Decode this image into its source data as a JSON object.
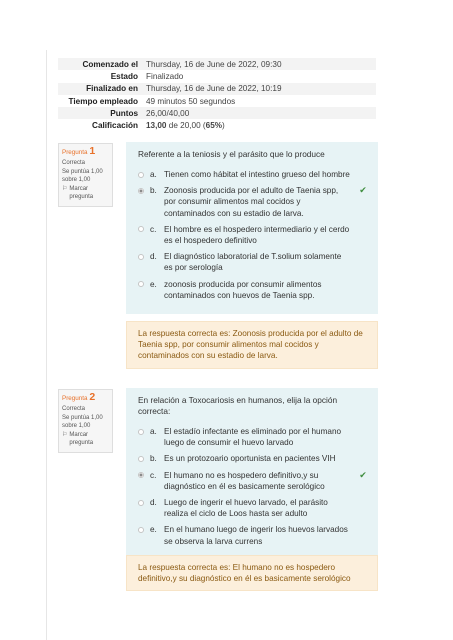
{
  "summary": [
    {
      "label": "Comenzado el",
      "value": "Thursday, 16 de June de 2022, 09:30"
    },
    {
      "label": "Estado",
      "value": "Finalizado"
    },
    {
      "label": "Finalizado en",
      "value": "Thursday, 16 de June de 2022, 10:19"
    },
    {
      "label": "Tiempo empleado",
      "value": "49 minutos 50 segundos"
    },
    {
      "label": "Puntos",
      "value": "26,00/40,00"
    },
    {
      "label": "Calificación",
      "value_bold": "13,00",
      "value_mid": " de 20,00 (",
      "value_pct": "65%",
      "value_end": ")"
    }
  ],
  "questions": [
    {
      "label": "Pregunta",
      "number": "1",
      "state": "Correcta",
      "mark": "Se puntúa 1,00 sobre 1,00",
      "flag_icon": "flag-icon",
      "flag_label": "Marcar pregunta",
      "text": "Referente a la teniosis y el parásito que lo produce",
      "options": [
        {
          "letter": "a.",
          "text": "Tienen como hábitat el intestino grueso del hombre",
          "selected": false,
          "correct": false
        },
        {
          "letter": "b.",
          "text": "Zoonosis producida por el adulto de Taenia spp, por consumir alimentos mal cocidos y contaminados con su estadio de larva.",
          "selected": true,
          "correct": true
        },
        {
          "letter": "c.",
          "text": "El hombre es el hospedero intermediario y el cerdo es el hospedero definitivo",
          "selected": false,
          "correct": false
        },
        {
          "letter": "d.",
          "text": "El diagnóstico laboratorial de T.solium solamente es por serología",
          "selected": false,
          "correct": false
        },
        {
          "letter": "e.",
          "text": "zoonosis producida por consumir alimentos contaminados con huevos de Taenia spp.",
          "selected": false,
          "correct": false
        }
      ],
      "feedback": "La respuesta correcta es: Zoonosis producida por el adulto de Taenia spp, por consumir alimentos mal cocidos y contaminados con su estadio de larva."
    },
    {
      "label": "Pregunta",
      "number": "2",
      "state": "Correcta",
      "mark": "Se puntúa 1,00 sobre 1,00",
      "flag_icon": "flag-icon",
      "flag_label": "Marcar pregunta",
      "text": "En relación a Toxocariosis en humanos, elija la opción correcta:",
      "options": [
        {
          "letter": "a.",
          "text": "El estadío infectante es eliminado por el humano luego de consumir el huevo larvado",
          "selected": false,
          "correct": false
        },
        {
          "letter": "b.",
          "text": "Es un protozoario oportunista en pacientes VIH",
          "selected": false,
          "correct": false
        },
        {
          "letter": "c.",
          "text": "El humano no es hospedero definitivo,y su diagnóstico en él es basicamente serológico",
          "selected": true,
          "correct": true
        },
        {
          "letter": "d.",
          "text": "Luego de ingerir el huevo larvado, el parásito realiza el ciclo de Loos hasta ser adulto",
          "selected": false,
          "correct": false
        },
        {
          "letter": "e.",
          "text": "En el humano luego de ingerir los huevos larvados se observa la larva currens",
          "selected": false,
          "correct": false
        }
      ],
      "feedback": "La respuesta correcta es: El humano no es hospedero definitivo,y su diagnóstico en él es basicamente serológico"
    }
  ],
  "icons": {
    "check": "✔",
    "flag": "⚐"
  },
  "colors": {
    "question_bg": "#e7f3f5",
    "feedback_bg": "#fcefdc",
    "feedback_text": "#8a5a12",
    "question_number": "#e8712a",
    "check": "#3f8d3f"
  }
}
